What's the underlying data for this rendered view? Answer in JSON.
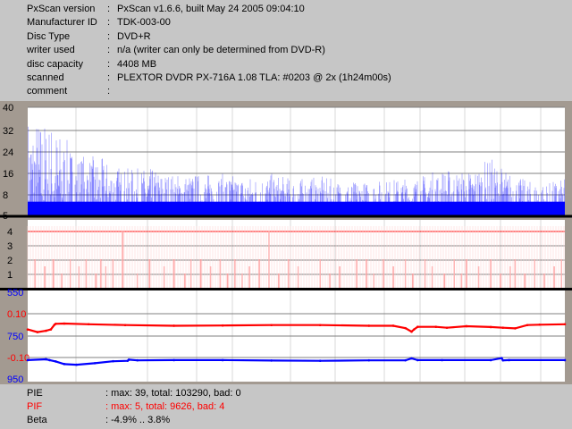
{
  "info": [
    {
      "label": "PxScan version",
      "value": "PxScan v1.6.6, built May 24 2005 09:04:10"
    },
    {
      "label": "Manufacturer ID",
      "value": "TDK-003-00"
    },
    {
      "label": "Disc Type",
      "value": "DVD+R"
    },
    {
      "label": "writer used",
      "value": "n/a (writer can only be determined from DVD-R)"
    },
    {
      "label": "disc capacity",
      "value": "4408 MB"
    },
    {
      "label": "scanned",
      "value": "PLEXTOR DVDR PX-716A 1.08 TLA: #0203 @ 2x (1h24m00s)"
    },
    {
      "label": "comment",
      "value": ""
    }
  ],
  "info_colon": ":",
  "summary": [
    {
      "label": "PIE",
      "value": ": max: 39, total: 103290, bad: 0",
      "color": "#000000"
    },
    {
      "label": "PIF",
      "value": ": max: 5, total: 9626, bad: 4",
      "color": "#ff0000"
    },
    {
      "label": "Beta",
      "value": ": -4.9% .. 3.8%",
      "color": "#000000"
    }
  ],
  "colors": {
    "pie": "#0000ff",
    "pif": "#ff0000",
    "beta_upper": "#ff0000",
    "beta_lower": "#0000ff",
    "plot_bg": "#ffffff",
    "frame_bg": "#a39a91",
    "info_bg": "#c6c6c6"
  },
  "chart_data": [
    {
      "type": "bar",
      "name": "PIE",
      "yticks": [
        "40",
        "32",
        "24",
        "16",
        "8",
        "5"
      ],
      "ylim": [
        5,
        40
      ],
      "max": 39,
      "x_units": "disc position (MB)",
      "xlim": [
        0,
        4408
      ],
      "envelope_x": [
        0,
        200,
        400,
        600,
        800,
        1000,
        1200,
        1400,
        1600,
        1800,
        2000,
        2200,
        2400,
        2600,
        2800,
        3000,
        3200,
        3400,
        3600,
        3800,
        4000,
        4200,
        4408
      ],
      "envelope_y": [
        39,
        36,
        24,
        22,
        18,
        18,
        16,
        16,
        16,
        15,
        16,
        14,
        15,
        13,
        13,
        14,
        15,
        18,
        17,
        22,
        15,
        12,
        14
      ]
    },
    {
      "type": "bar",
      "name": "PIF",
      "yticks": [
        "4",
        "3",
        "2",
        "1"
      ],
      "ylim": [
        0,
        4
      ],
      "max": 5,
      "bars": [
        {
          "x": 60,
          "v": 2.0
        },
        {
          "x": 140,
          "v": 1.5
        },
        {
          "x": 210,
          "v": 2.0
        },
        {
          "x": 280,
          "v": 1.0
        },
        {
          "x": 350,
          "v": 2.0
        },
        {
          "x": 420,
          "v": 1.5
        },
        {
          "x": 480,
          "v": 2.0
        },
        {
          "x": 560,
          "v": 1.0
        },
        {
          "x": 600,
          "v": 2.0
        },
        {
          "x": 640,
          "v": 1.5
        },
        {
          "x": 700,
          "v": 2.0
        },
        {
          "x": 780,
          "v": 4.0
        },
        {
          "x": 900,
          "v": 1.0
        },
        {
          "x": 1000,
          "v": 2.0
        },
        {
          "x": 1120,
          "v": 1.5
        },
        {
          "x": 1200,
          "v": 2.0
        },
        {
          "x": 1290,
          "v": 1.0
        },
        {
          "x": 1340,
          "v": 2.0
        },
        {
          "x": 1420,
          "v": 2.0
        },
        {
          "x": 1500,
          "v": 1.5
        },
        {
          "x": 1580,
          "v": 2.0
        },
        {
          "x": 1640,
          "v": 1.0
        },
        {
          "x": 1700,
          "v": 2.0
        },
        {
          "x": 1760,
          "v": 1.0
        },
        {
          "x": 1820,
          "v": 1.5
        },
        {
          "x": 1900,
          "v": 2.0
        },
        {
          "x": 1980,
          "v": 4.0
        },
        {
          "x": 2060,
          "v": 1.0
        },
        {
          "x": 2140,
          "v": 2.0
        },
        {
          "x": 2220,
          "v": 1.5
        },
        {
          "x": 2400,
          "v": 2.0
        },
        {
          "x": 2480,
          "v": 1.0
        },
        {
          "x": 2560,
          "v": 1.5
        },
        {
          "x": 2700,
          "v": 2.0
        },
        {
          "x": 2780,
          "v": 2.0
        },
        {
          "x": 2840,
          "v": 1.0
        },
        {
          "x": 2920,
          "v": 2.0
        },
        {
          "x": 3000,
          "v": 1.5
        },
        {
          "x": 3100,
          "v": 2.0
        },
        {
          "x": 3160,
          "v": 1.0
        },
        {
          "x": 3260,
          "v": 2.0
        },
        {
          "x": 3320,
          "v": 1.5
        },
        {
          "x": 3420,
          "v": 1.0
        },
        {
          "x": 3500,
          "v": 2.0
        },
        {
          "x": 3560,
          "v": 1.0
        },
        {
          "x": 3600,
          "v": 2.0
        },
        {
          "x": 3700,
          "v": 1.5
        },
        {
          "x": 3800,
          "v": 2.0
        },
        {
          "x": 3880,
          "v": 1.0
        },
        {
          "x": 3960,
          "v": 1.5
        },
        {
          "x": 4000,
          "v": 2.0
        },
        {
          "x": 4080,
          "v": 1.0
        },
        {
          "x": 4160,
          "v": 2.0
        },
        {
          "x": 4240,
          "v": 1.0
        },
        {
          "x": 4320,
          "v": 1.5
        },
        {
          "x": 4380,
          "v": 2.0
        }
      ]
    },
    {
      "type": "line",
      "name": "Beta",
      "left_ticks": [
        "550",
        "750",
        "950"
      ],
      "right_ticks": [
        "0.10",
        "-0.10"
      ],
      "ylim": [
        -0.15,
        0.15
      ],
      "upper": {
        "x": [
          0,
          80,
          150,
          190,
          220,
          230,
          300,
          500,
          800,
          1200,
          1600,
          2000,
          2400,
          2800,
          3000,
          3100,
          3150,
          3170,
          3200,
          3350,
          3440,
          3600,
          3800,
          3900,
          4000,
          4100,
          4200,
          4408
        ],
        "y": [
          0.028,
          0.016,
          0.022,
          0.028,
          0.05,
          0.054,
          0.055,
          0.052,
          0.048,
          0.045,
          0.046,
          0.048,
          0.048,
          0.045,
          0.045,
          0.034,
          0.018,
          0.028,
          0.04,
          0.04,
          0.036,
          0.043,
          0.039,
          0.036,
          0.033,
          0.048,
          0.05,
          0.052
        ]
      },
      "lower": {
        "x": [
          0,
          150,
          180,
          230,
          300,
          400,
          550,
          700,
          820,
          830,
          900,
          1200,
          1600,
          2000,
          2400,
          2800,
          3100,
          3150,
          3200,
          3400,
          3800,
          3890,
          3900,
          3950,
          4408
        ],
        "y": [
          -0.112,
          -0.108,
          -0.112,
          -0.118,
          -0.13,
          -0.133,
          -0.126,
          -0.117,
          -0.115,
          -0.11,
          -0.113,
          -0.112,
          -0.112,
          -0.114,
          -0.115,
          -0.113,
          -0.113,
          -0.104,
          -0.112,
          -0.112,
          -0.112,
          -0.103,
          -0.113,
          -0.112,
          -0.112
        ]
      }
    }
  ]
}
